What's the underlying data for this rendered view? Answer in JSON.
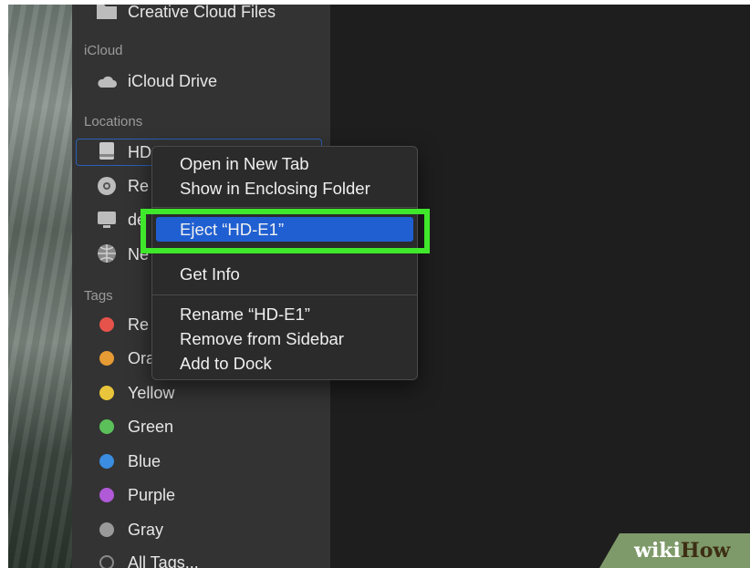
{
  "sidebar": {
    "top_item": {
      "label": "Creative Cloud Files",
      "icon": "folder-icon"
    },
    "icloud": {
      "heading": "iCloud",
      "items": [
        {
          "label": "iCloud Drive",
          "icon": "cloud-icon"
        }
      ]
    },
    "locations": {
      "heading": "Locations",
      "items": [
        {
          "label": "HD",
          "icon": "hard-drive-icon",
          "selected": true
        },
        {
          "label": "Re",
          "icon": "optical-disc-icon"
        },
        {
          "label": "de",
          "icon": "display-icon"
        },
        {
          "label": "Ne",
          "icon": "network-icon"
        }
      ]
    },
    "tags": {
      "heading": "Tags",
      "items": [
        {
          "label": "Re",
          "color": "#e5534b"
        },
        {
          "label": "Ora",
          "color": "#e69b35"
        },
        {
          "label": "Yellow",
          "color": "#e8c53a"
        },
        {
          "label": "Green",
          "color": "#5cc05a"
        },
        {
          "label": "Blue",
          "color": "#3a8de0"
        },
        {
          "label": "Purple",
          "color": "#b05ad8"
        },
        {
          "label": "Gray",
          "color": "#9a9a9a"
        },
        {
          "label": "All Tags...",
          "color": null
        }
      ]
    }
  },
  "context_menu": {
    "items": [
      {
        "label": "Open in New Tab"
      },
      {
        "label": "Show in Enclosing Folder"
      },
      {
        "label": "Eject “HD-E1”",
        "highlighted": true
      },
      {
        "label": "Get Info"
      },
      {
        "label": "Rename “HD-E1”"
      },
      {
        "label": "Remove from Sidebar"
      },
      {
        "label": "Add to Dock"
      }
    ],
    "highlight_color": "#1f5fd1",
    "callout_color": "#3fe82a"
  },
  "watermark": {
    "part1": "wiki",
    "part2": "How"
  }
}
